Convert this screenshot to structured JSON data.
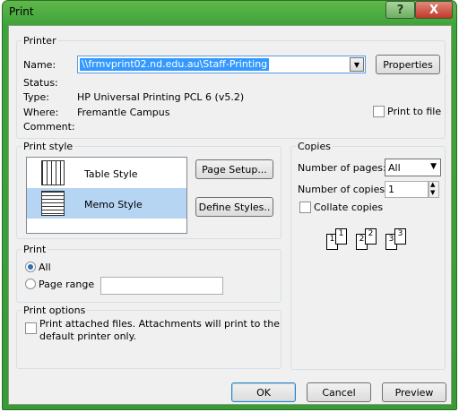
{
  "window": {
    "title": "Print",
    "help_label": "?",
    "close_label": "X"
  },
  "printer": {
    "group_label": "Printer",
    "name_label": "Name:",
    "name_value": "\\\\frmvprint02.nd.edu.au\\Staff-Printing",
    "properties_label": "Properties",
    "status_label": "Status:",
    "status_value": "",
    "type_label": "Type:",
    "type_value": "HP Universal Printing PCL 6 (v5.2)",
    "where_label": "Where:",
    "where_value": "Fremantle Campus",
    "comment_label": "Comment:",
    "comment_value": "",
    "print_to_file_label": "Print to file"
  },
  "print_style": {
    "group_label": "Print style",
    "styles": [
      {
        "label": "Table Style",
        "icon": "table-style-icon",
        "selected": false
      },
      {
        "label": "Memo Style",
        "icon": "memo-style-icon",
        "selected": true
      }
    ],
    "page_setup_label": "Page Setup...",
    "define_styles_label": "Define Styles.."
  },
  "copies": {
    "group_label": "Copies",
    "pages_label": "Number of pages:",
    "pages_value": "All",
    "copies_label": "Number of copies:",
    "copies_value": "1",
    "collate_label": "Collate copies",
    "collate_pages": [
      "1",
      "1",
      "2",
      "2",
      "3",
      "3"
    ]
  },
  "print_range": {
    "group_label": "Print",
    "all_label": "All",
    "page_range_label": "Page range",
    "page_range_value": ""
  },
  "print_options": {
    "group_label": "Print options",
    "attached_label_line1": "Print attached files.  Attachments will print to the",
    "attached_label_line2": "default printer only."
  },
  "footer": {
    "ok_label": "OK",
    "cancel_label": "Cancel",
    "preview_label": "Preview"
  },
  "colors": {
    "frame": "#3fa33a",
    "selection": "#b5d5f2",
    "accent": "#3c7fb1"
  }
}
